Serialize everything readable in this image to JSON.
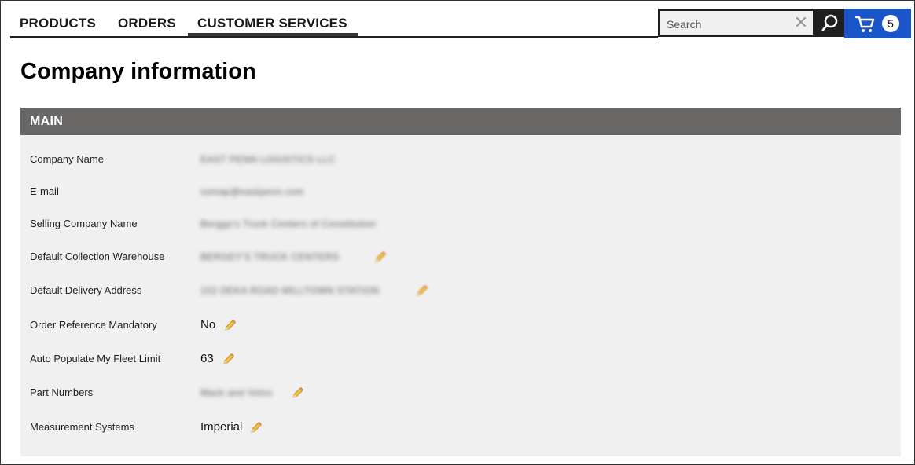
{
  "nav": {
    "tabs": [
      {
        "label": "PRODUCTS"
      },
      {
        "label": "ORDERS"
      },
      {
        "label": "CUSTOMER SERVICES"
      }
    ],
    "active_tab": "CUSTOMER SERVICES",
    "search_placeholder": "Search",
    "cart_count": "5",
    "cart_color": "#1a56c9"
  },
  "page_title": "Company information",
  "section": {
    "title": "MAIN",
    "header_color": "#686765",
    "fields": [
      {
        "label": "Company Name",
        "value": "EAST PENN LOGISTICS LLC",
        "redacted": true,
        "editable": false
      },
      {
        "label": "E-mail",
        "value": "ssmap@eastpenn.com",
        "redacted": true,
        "editable": false
      },
      {
        "label": "Selling Company Name",
        "value": "Berggs's Truck Centers of Constitution",
        "redacted": true,
        "editable": false
      },
      {
        "label": "Default Collection Warehouse",
        "value": "BERGEY'S TRUCK CENTERS",
        "redacted": true,
        "editable": true
      },
      {
        "label": "Default Delivery Address",
        "value": "102 DEKA ROAD MILLTOWN STATION",
        "redacted": true,
        "editable": true
      },
      {
        "label": "Order Reference Mandatory",
        "value": "No",
        "redacted": false,
        "editable": true
      },
      {
        "label": "Auto Populate My Fleet Limit",
        "value": "63",
        "redacted": false,
        "editable": true
      },
      {
        "label": "Part Numbers",
        "value": "Mack and Volvo",
        "redacted": true,
        "editable": true
      },
      {
        "label": "Measurement Systems",
        "value": "Imperial",
        "redacted": false,
        "editable": true
      }
    ]
  }
}
